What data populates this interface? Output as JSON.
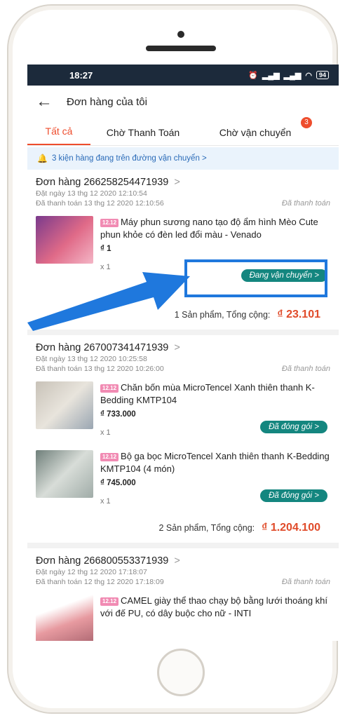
{
  "status_bar": {
    "time": "18:27",
    "battery": "94"
  },
  "header": {
    "title": "Đơn hàng của tôi"
  },
  "tabs": [
    {
      "label": "Tất cả"
    },
    {
      "label": "Chờ Thanh Toán"
    },
    {
      "label": "Chờ vận chuyển",
      "badge": "3"
    }
  ],
  "notice": {
    "text": "3 kiện hàng đang trên đường vận chuyển >"
  },
  "orders": [
    {
      "title": "Đơn hàng 266258254471939",
      "placed": "Đặt ngày 13 thg 12 2020  12:10:54",
      "paid": "Đã thanh toán 13 thg 12 2020  12:10:56",
      "status": "Đã thanh toán",
      "items": [
        {
          "tag": "12.12",
          "name": "Máy phun sương nano tạo độ ẩm hình Mèo Cute phun khỏe có đèn led đổi màu - Venado",
          "price": "₫ 1",
          "qty": "x 1",
          "action": "Đang vận chuyển >"
        }
      ],
      "total_label": "1 Sản phẩm, Tổng cộng:",
      "total_value": "₫ 23.101"
    },
    {
      "title": "Đơn hàng 267007341471939",
      "placed": "Đặt ngày 13 thg 12 2020  10:25:58",
      "paid": "Đã thanh toán 13 thg 12 2020  10:26:00",
      "status": "Đã thanh toán",
      "items": [
        {
          "tag": "12.12",
          "name": "Chăn bốn mùa MicroTencel Xanh thiên thanh K-Bedding KMTP104",
          "price": "₫ 733.000",
          "qty": "x 1",
          "action": "Đã đóng gói >"
        },
        {
          "tag": "12.12",
          "name": "Bộ ga bọc MicroTencel Xanh thiên thanh K-Bedding KMTP104 (4 món)",
          "price": "₫ 745.000",
          "qty": "x 1",
          "action": "Đã đóng gói >"
        }
      ],
      "total_label": "2 Sản phẩm, Tổng cộng:",
      "total_value": "₫ 1.204.100"
    },
    {
      "title": "Đơn hàng 266800553371939",
      "placed": "Đặt ngày 12 thg 12 2020  17:18:07",
      "paid": "Đã thanh toán 12 thg 12 2020  17:18:09",
      "status": "Đã thanh toán",
      "items": [
        {
          "tag": "12.12",
          "name": "CAMEL giày thể thao chạy bộ bằng lưới thoáng khí với đế PU, có dây buộc cho nữ - INTI"
        }
      ]
    }
  ],
  "colors": {
    "accent": "#ee4d2d",
    "action_pill": "#14867f",
    "highlight": "#1f78dd",
    "status_bar": "#1c2a3b"
  }
}
